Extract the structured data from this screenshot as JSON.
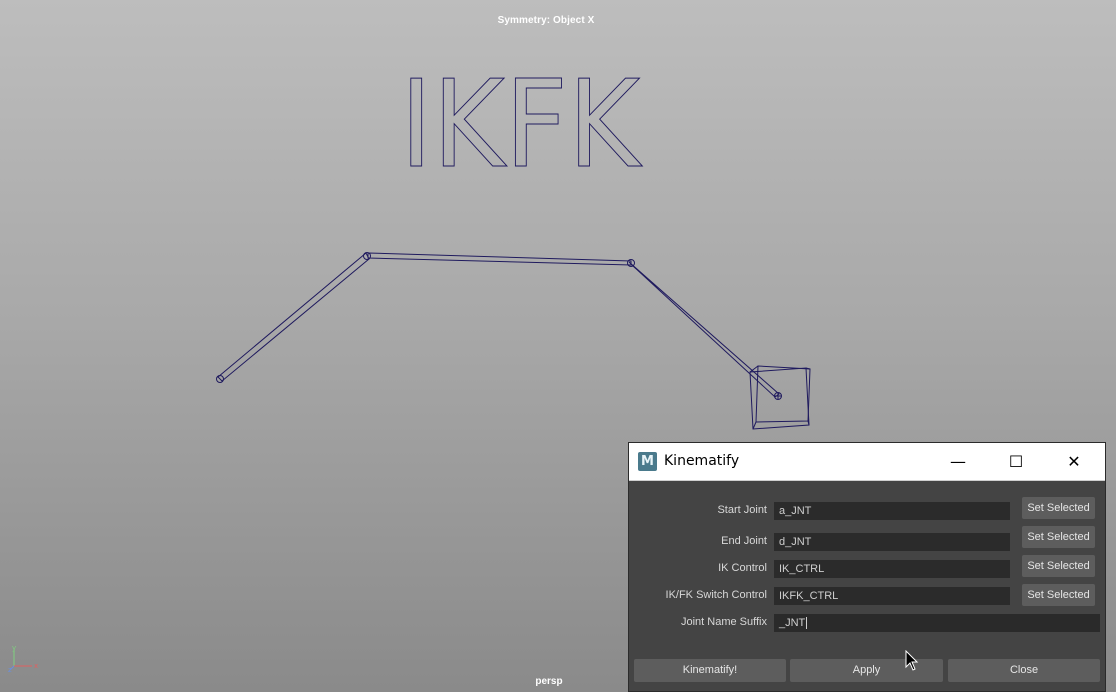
{
  "viewport": {
    "symmetry_label": "Symmetry: Object X",
    "camera_label": "persp",
    "scene_text": "IKFK",
    "axis": {
      "x": "x",
      "y": "y",
      "z": "z"
    }
  },
  "dialog": {
    "title": "Kinematify",
    "icon_letter": "M",
    "minimize_glyph": "—",
    "maximize_glyph": "☐",
    "close_glyph": "✕",
    "rows": [
      {
        "label": "Start Joint",
        "value": "a_JNT",
        "button": "Set Selected"
      },
      {
        "label": "End Joint",
        "value": "d_JNT",
        "button": "Set Selected"
      },
      {
        "label": "IK Control",
        "value": "IK_CTRL",
        "button": "Set Selected"
      },
      {
        "label": "IK/FK Switch Control",
        "value": "IKFK_CTRL",
        "button": "Set Selected"
      }
    ],
    "suffix": {
      "label": "Joint Name Suffix",
      "value": "_JNT"
    },
    "buttons": {
      "kinematify": "Kinematify!",
      "apply": "Apply",
      "close": "Close"
    }
  },
  "colors": {
    "wire": "#1f1a5e",
    "dialog_bg": "#444444",
    "field_bg": "#2b2b2b",
    "button_bg": "#5d5d5d"
  }
}
